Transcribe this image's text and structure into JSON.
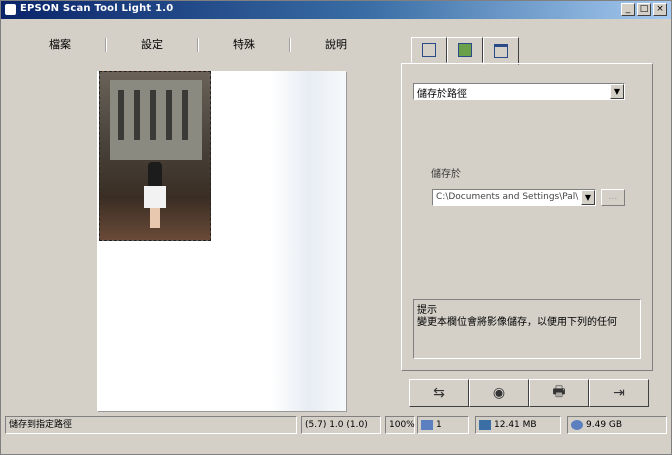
{
  "window": {
    "title": "EPSON Scan Tool Light 1.0",
    "buttons": [
      "_",
      "□",
      "×"
    ]
  },
  "menu": {
    "items": [
      "檔案",
      "設定",
      "特殊",
      "說明"
    ]
  },
  "tabs": [
    {
      "icon": "scan-settings-icon"
    },
    {
      "icon": "image-adjust-icon"
    },
    {
      "icon": "output-icon"
    }
  ],
  "panel": {
    "dropdown_value": "儲存於路徑",
    "save_label": "儲存於",
    "path_value": "C:\\Documents and Settings\\Pal\\",
    "browse_label": "..."
  },
  "hint": {
    "title": "提示",
    "text": "變更本欄位會將影像儲存，以便用下列的任何"
  },
  "actions": [
    {
      "name": "preview-button",
      "icon": "preview-icon",
      "glyph": "⇆"
    },
    {
      "name": "scan-button",
      "icon": "scan-icon",
      "glyph": "◉"
    },
    {
      "name": "print-button",
      "icon": "print-icon",
      "glyph": "🖶"
    },
    {
      "name": "exit-button",
      "icon": "exit-icon",
      "glyph": "⇥"
    }
  ],
  "status": {
    "message": "儲存到指定路徑",
    "dimensions": "(5.7) 1.0 (1.0)",
    "zoom": "100%",
    "copies": "1",
    "file_size": "12.41 MB",
    "free_space": "9.49 GB"
  }
}
